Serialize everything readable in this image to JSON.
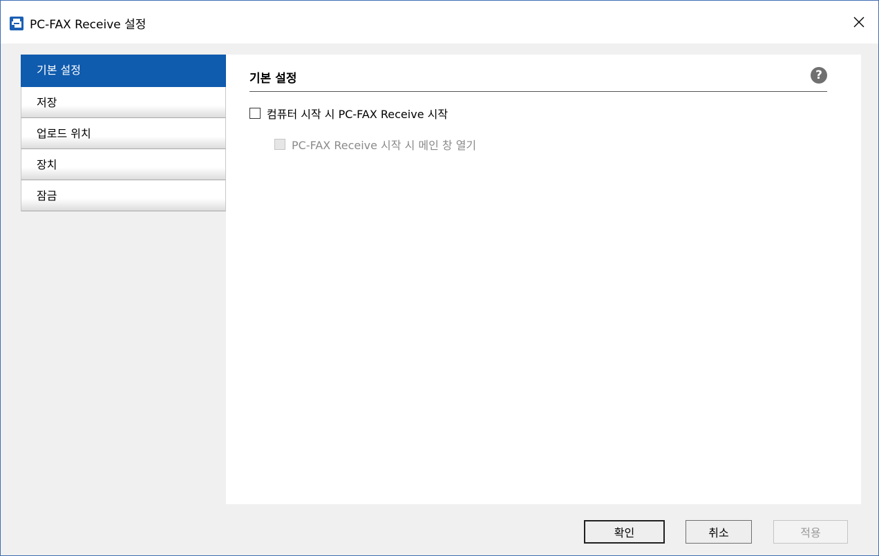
{
  "window": {
    "title": "PC-FAX Receive 설정"
  },
  "sidebar": {
    "items": [
      {
        "label": "기본 설정"
      },
      {
        "label": "저장"
      },
      {
        "label": "업로드 위치"
      },
      {
        "label": "장치"
      },
      {
        "label": "잠금"
      }
    ],
    "selected": "기본 설정"
  },
  "content": {
    "title": "기본 설정",
    "options": [
      {
        "label": "컴퓨터 시작 시 PC-FAX Receive 시작",
        "checked": false,
        "enabled": true
      },
      {
        "label": "PC-FAX Receive 시작 시 메인 창 열기",
        "checked": false,
        "enabled": false
      }
    ]
  },
  "buttons": {
    "ok": "확인",
    "cancel": "취소",
    "apply": "적용"
  },
  "colors": {
    "accent": "#0f5bae",
    "window_border": "#3c6cb4"
  },
  "icons": {
    "app": "fax-icon",
    "close": "close-icon",
    "help": "help-icon"
  }
}
